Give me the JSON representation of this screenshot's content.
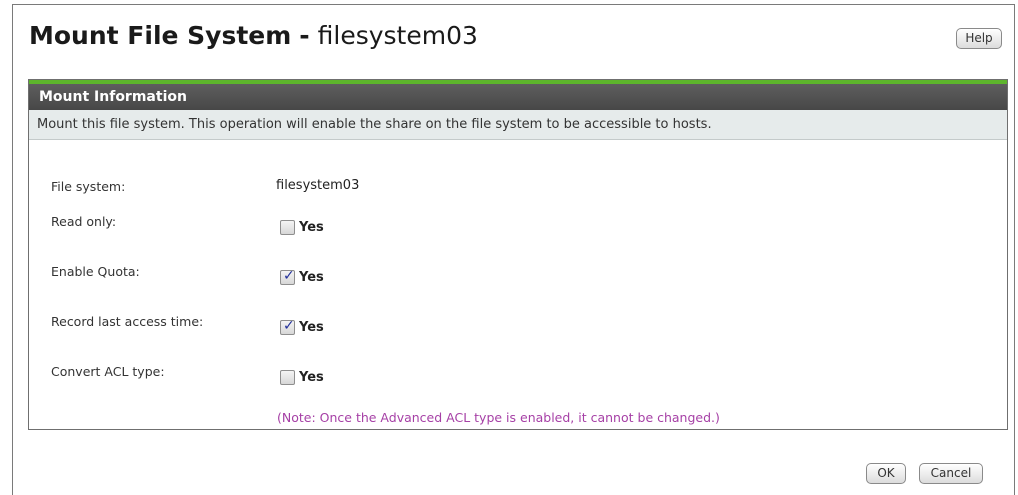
{
  "dialog": {
    "title_bold": "Mount File System",
    "title_separator": "-",
    "title_name": "filesystem03",
    "help_label": "Help",
    "ok_label": "OK",
    "cancel_label": "Cancel"
  },
  "panel": {
    "header": "Mount Information",
    "description": "Mount this file system. This operation will enable the share on the file system to be accessible to hosts."
  },
  "fields": {
    "file_system": {
      "label": "File system:",
      "value": "filesystem03"
    },
    "read_only": {
      "label": "Read only:",
      "option": "Yes",
      "checked": false
    },
    "enable_quota": {
      "label": "Enable Quota:",
      "option": "Yes",
      "checked": true
    },
    "record_last_access": {
      "label": "Record last access time:",
      "option": "Yes",
      "checked": true
    },
    "convert_acl": {
      "label": "Convert ACL type:",
      "option": "Yes",
      "checked": false
    },
    "note": "(Note: Once the Advanced ACL type is enabled, it cannot be changed.)"
  },
  "colors": {
    "accent": "#5db52c",
    "header_bg": "#4f4f4f",
    "desc_bg": "#e6ebeb",
    "note": "#a640a6",
    "check": "#22309a"
  }
}
